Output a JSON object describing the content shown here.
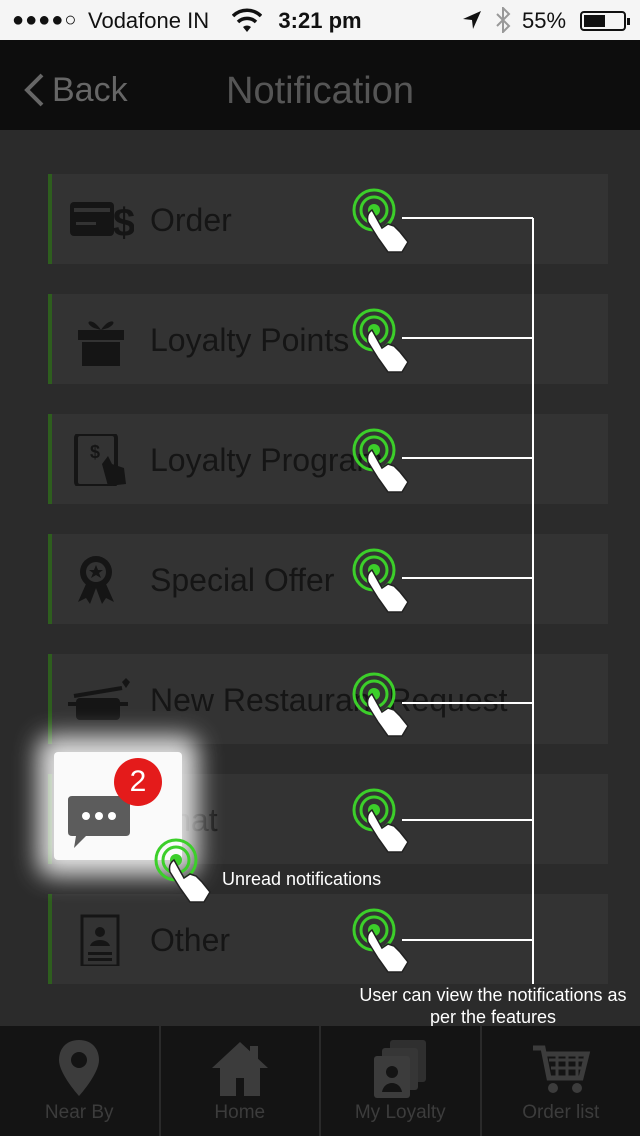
{
  "status_bar": {
    "signal": "●●●●○",
    "carrier": "Vodafone IN",
    "time": "3:21 pm",
    "battery": "55%",
    "battery_level": 0.55
  },
  "header": {
    "back_label": "Back",
    "title": "Notification"
  },
  "rows": [
    {
      "label": "Order",
      "icon": "order-icon"
    },
    {
      "label": "Loyalty Points",
      "icon": "gift-icon"
    },
    {
      "label": "Loyalty Program",
      "icon": "tablet-icon"
    },
    {
      "label": "Special Offer",
      "icon": "award-icon"
    },
    {
      "label": "New Restaurant Request",
      "icon": "pot-icon"
    },
    {
      "label": "Chat",
      "icon": "chat-icon"
    },
    {
      "label": "Other",
      "icon": "document-icon"
    }
  ],
  "chat_badge": "2",
  "annotations": {
    "unread": "Unread notifications",
    "features": "User can view the notifications as per the features"
  },
  "tabs": [
    {
      "label": "Near By",
      "icon": "location-pin-icon"
    },
    {
      "label": "Home",
      "icon": "home-icon"
    },
    {
      "label": "My Loyalty",
      "icon": "loyalty-cards-icon"
    },
    {
      "label": "Order list",
      "icon": "cart-icon"
    }
  ],
  "colors": {
    "accent_green": "#2e5e1e",
    "tap_green": "#3ccf2a",
    "badge_red": "#e41b1b"
  }
}
